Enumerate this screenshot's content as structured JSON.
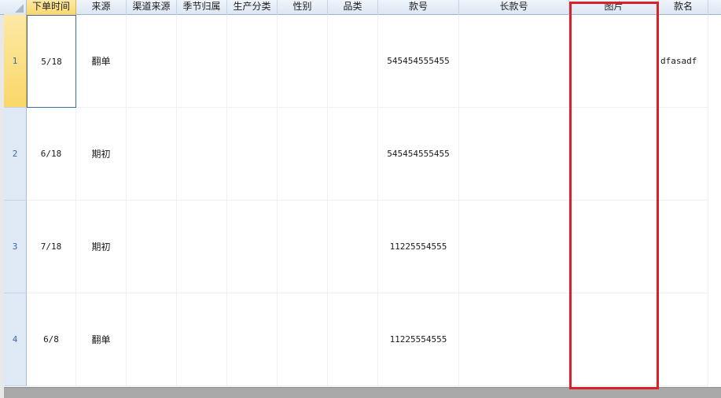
{
  "grid": {
    "columns": [
      {
        "key": "order_time",
        "label": "下单时间"
      },
      {
        "key": "source",
        "label": "来源"
      },
      {
        "key": "channel_source",
        "label": "渠道来源"
      },
      {
        "key": "season",
        "label": "季节归属"
      },
      {
        "key": "production_category",
        "label": "生产分类"
      },
      {
        "key": "gender",
        "label": "性别"
      },
      {
        "key": "category",
        "label": "品类"
      },
      {
        "key": "style_no",
        "label": "款号"
      },
      {
        "key": "long_style_no",
        "label": "长款号"
      },
      {
        "key": "image",
        "label": "图片"
      },
      {
        "key": "style_name",
        "label": "款名"
      }
    ],
    "rows": [
      {
        "row_number": "1",
        "order_time": "5/18",
        "source": "翻单",
        "channel_source": "",
        "season": "",
        "production_category": "",
        "gender": "",
        "category": "",
        "style_no": "545454555455",
        "long_style_no": "",
        "image": "",
        "style_name": "dfasadf"
      },
      {
        "row_number": "2",
        "order_time": "6/18",
        "source": "期初",
        "channel_source": "",
        "season": "",
        "production_category": "",
        "gender": "",
        "category": "",
        "style_no": "545454555455",
        "long_style_no": "",
        "image": "",
        "style_name": ""
      },
      {
        "row_number": "3",
        "order_time": "7/18",
        "source": "期初",
        "channel_source": "",
        "season": "",
        "production_category": "",
        "gender": "",
        "category": "",
        "style_no": "11225554555",
        "long_style_no": "",
        "image": "",
        "style_name": ""
      },
      {
        "row_number": "4",
        "order_time": "6/8",
        "source": "翻单",
        "channel_source": "",
        "season": "",
        "production_category": "",
        "gender": "",
        "category": "",
        "style_no": "11225554555",
        "long_style_no": "",
        "image": "",
        "style_name": ""
      }
    ],
    "active_column": "order_time",
    "active_row": "1"
  },
  "colors": {
    "highlight_box": "#d9212a",
    "header_active": "#f9d768",
    "row_number_text": "#3b66a8"
  }
}
